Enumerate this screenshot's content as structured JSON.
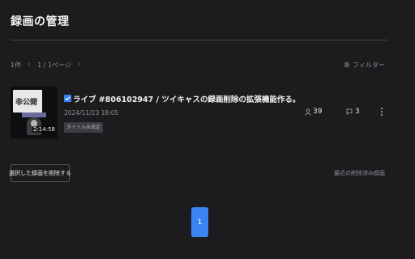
{
  "header": {
    "title": "録画の管理"
  },
  "pager_top": {
    "count": "1件",
    "page_info": "1 / 1ページ",
    "prev_icon": "chevron-left-icon",
    "next_icon": "chevron-right-icon"
  },
  "filter": {
    "label": "フィルター",
    "icon": "filter-icon"
  },
  "recordings": [
    {
      "thumbnail_text": "非公開",
      "duration": "2:14:58",
      "checked": true,
      "title": "ライブ #806102947 / ツイキャスの録画削除の拡張機能作る。",
      "datetime": "2024/11/23 18:05",
      "badge": "タイトル未設定",
      "viewers": "39",
      "comments": "3"
    }
  ],
  "actions": {
    "delete_selected": "選択した録画を削除する",
    "recently_deleted": "最近の削除済み録画"
  },
  "pagination": {
    "pages": [
      "1"
    ],
    "current": "1"
  },
  "colors": {
    "background": "#1c1c1f",
    "accent": "#3a84f4",
    "muted_text": "#8e8e96"
  }
}
